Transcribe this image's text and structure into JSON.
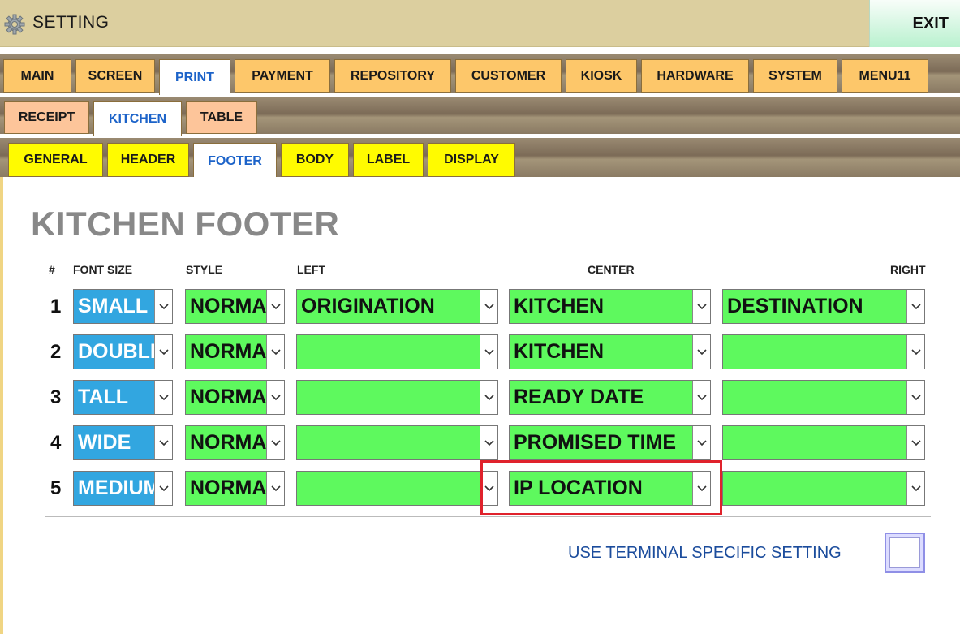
{
  "window": {
    "title": "SETTING",
    "exit_label": "EXIT"
  },
  "tabs_main": [
    "MAIN",
    "SCREEN",
    "PRINT",
    "PAYMENT",
    "REPOSITORY",
    "CUSTOMER",
    "KIOSK",
    "HARDWARE",
    "SYSTEM",
    "MENU11"
  ],
  "tabs_main_active": "PRINT",
  "tabs_print": [
    "RECEIPT",
    "KITCHEN",
    "TABLE"
  ],
  "tabs_print_active": "KITCHEN",
  "tabs_kitchen": [
    "GENERAL",
    "HEADER",
    "FOOTER",
    "BODY",
    "LABEL",
    "DISPLAY"
  ],
  "tabs_kitchen_active": "FOOTER",
  "page_title": "KITCHEN FOOTER",
  "columns": {
    "num": "#",
    "font_size": "FONT SIZE",
    "style": "STYLE",
    "left": "LEFT",
    "center": "CENTER",
    "right": "RIGHT"
  },
  "rows": [
    {
      "num": "1",
      "font_size": "SMALL",
      "style": "NORMAL",
      "left": "ORIGINATION",
      "center": "KITCHEN",
      "right": "DESTINATION"
    },
    {
      "num": "2",
      "font_size": "DOUBLE",
      "style": "NORMAL",
      "left": "",
      "center": "KITCHEN",
      "right": ""
    },
    {
      "num": "3",
      "font_size": "TALL",
      "style": "NORMAL",
      "left": "",
      "center": "READY DATE",
      "right": ""
    },
    {
      "num": "4",
      "font_size": "WIDE",
      "style": "NORMAL",
      "left": "",
      "center": "PROMISED TIME",
      "right": ""
    },
    {
      "num": "5",
      "font_size": "MEDIUM",
      "style": "NORMAL",
      "left": "",
      "center": "IP LOCATION",
      "right": ""
    }
  ],
  "terminal_setting": {
    "label": "USE TERMINAL SPECIFIC SETTING",
    "checked": false
  },
  "colors": {
    "font_size_bg": "#32a6e0",
    "field_bg": "#5ef95e",
    "highlight": "#e0222c",
    "active_tab_text": "#1c63c9"
  },
  "icons": {
    "title": "gear-icon",
    "dropdown": "chevron-down-icon"
  }
}
